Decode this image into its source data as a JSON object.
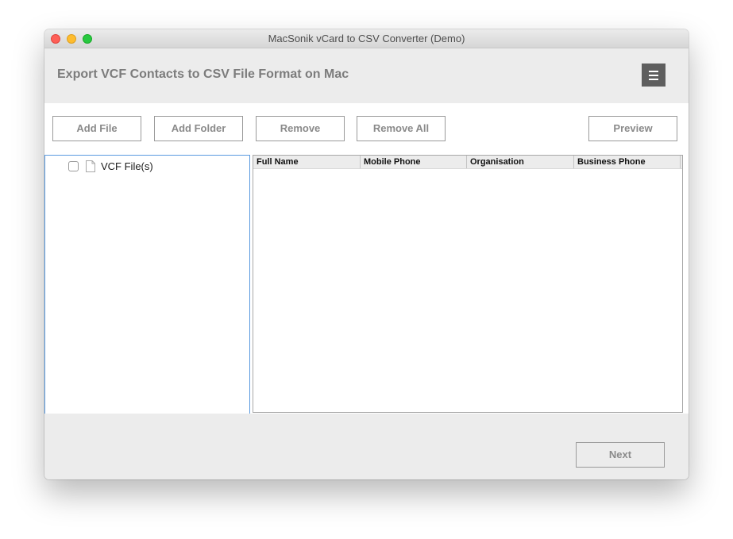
{
  "window": {
    "title": "MacSonik vCard to CSV Converter (Demo)"
  },
  "header": {
    "title": "Export VCF Contacts to CSV File Format on Mac",
    "menu_icon": "hamburger-menu-icon"
  },
  "toolbar": {
    "add_file": "Add File",
    "add_folder": "Add Folder",
    "remove": "Remove",
    "remove_all": "Remove All",
    "preview": "Preview"
  },
  "tree": {
    "root_label": "VCF File(s)",
    "root_icon": "file-icon",
    "checked": false
  },
  "grid": {
    "columns": [
      "Full Name",
      "Mobile Phone",
      "Organisation",
      "Business Phone"
    ],
    "rows": []
  },
  "footer": {
    "next": "Next"
  },
  "colors": {
    "menu_button_bg": "#5e5e5e",
    "tree_focus_border": "#5a9ae0",
    "window_bg": "#ececec"
  }
}
